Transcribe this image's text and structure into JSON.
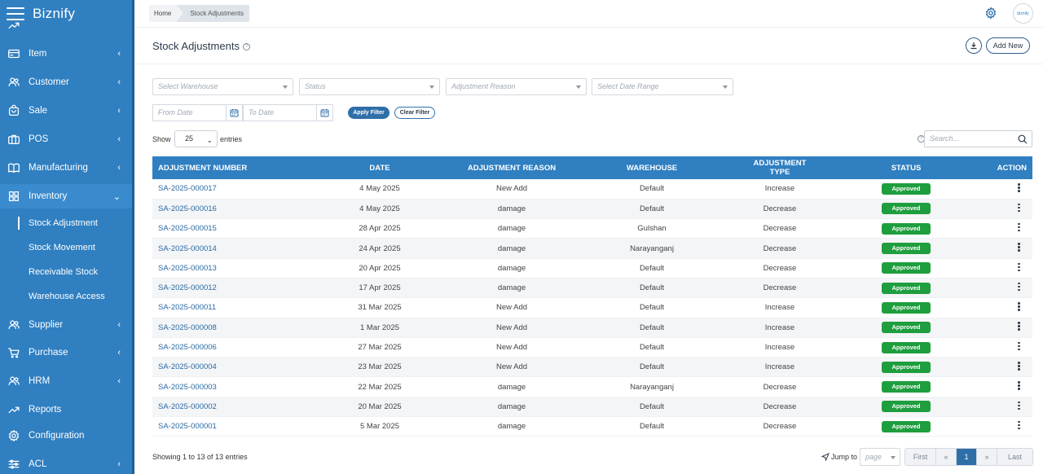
{
  "app": {
    "name": "Biznify",
    "avatar_text": "biznify"
  },
  "sidebar": {
    "items": [
      {
        "label": "Item",
        "icon": "card-icon"
      },
      {
        "label": "Customer",
        "icon": "users-icon"
      },
      {
        "label": "Sale",
        "icon": "bag-icon"
      },
      {
        "label": "POS",
        "icon": "briefcase-icon"
      },
      {
        "label": "Manufacturing",
        "icon": "book-icon"
      },
      {
        "label": "Inventory",
        "icon": "grid-icon"
      },
      {
        "label": "Supplier",
        "icon": "users-icon"
      },
      {
        "label": "Purchase",
        "icon": "cart-icon"
      },
      {
        "label": "HRM",
        "icon": "users-icon"
      },
      {
        "label": "Reports",
        "icon": "trend-icon"
      },
      {
        "label": "Configuration",
        "icon": "gear-icon"
      },
      {
        "label": "ACL",
        "icon": "sliders-icon"
      }
    ],
    "inventory_sub": [
      "Stock Adjustment",
      "Stock Movement",
      "Receivable Stock",
      "Warehouse Access"
    ]
  },
  "breadcrumb": {
    "home": "Home",
    "current": "Stock Adjustments"
  },
  "page": {
    "title": "Stock Adjustments",
    "info": "?",
    "add_new": "Add New"
  },
  "filters": {
    "warehouse": "Select Warehouse",
    "status": "Status",
    "reason": "Adjustment Reason",
    "date_range": "Select Date Range",
    "from_date": "From Date",
    "to_date": "To Date",
    "apply": "Apply Filter",
    "clear": "Clear Filter"
  },
  "table_controls": {
    "show": "Show",
    "page_size": "25",
    "entries": "entries",
    "search_placeholder": "Search..."
  },
  "table": {
    "columns": [
      "ADJUSTMENT NUMBER",
      "DATE",
      "ADJUSTMENT REASON",
      "WAREHOUSE",
      "ADJUSTMENT TYPE",
      "STATUS",
      "ACTION"
    ],
    "rows": [
      [
        "SA-2025-000017",
        "4 May 2025",
        "New Add",
        "Default",
        "Increase",
        "Approved"
      ],
      [
        "SA-2025-000016",
        "4 May 2025",
        "damage",
        "Default",
        "Decrease",
        "Approved"
      ],
      [
        "SA-2025-000015",
        "28 Apr 2025",
        "damage",
        "Gulshan",
        "Decrease",
        "Approved"
      ],
      [
        "SA-2025-000014",
        "24 Apr 2025",
        "damage",
        "Narayanganj",
        "Decrease",
        "Approved"
      ],
      [
        "SA-2025-000013",
        "20 Apr 2025",
        "damage",
        "Default",
        "Decrease",
        "Approved"
      ],
      [
        "SA-2025-000012",
        "17 Apr 2025",
        "damage",
        "Default",
        "Decrease",
        "Approved"
      ],
      [
        "SA-2025-000011",
        "31 Mar 2025",
        "New Add",
        "Default",
        "Increase",
        "Approved"
      ],
      [
        "SA-2025-000008",
        "1 Mar 2025",
        "New Add",
        "Default",
        "Increase",
        "Approved"
      ],
      [
        "SA-2025-000006",
        "27 Mar 2025",
        "New Add",
        "Default",
        "Increase",
        "Approved"
      ],
      [
        "SA-2025-000004",
        "23 Mar 2025",
        "New Add",
        "Default",
        "Increase",
        "Approved"
      ],
      [
        "SA-2025-000003",
        "22 Mar 2025",
        "damage",
        "Narayanganj",
        "Decrease",
        "Approved"
      ],
      [
        "SA-2025-000002",
        "20 Mar 2025",
        "damage",
        "Default",
        "Decrease",
        "Approved"
      ],
      [
        "SA-2025-000001",
        "5 Mar 2025",
        "damage",
        "Default",
        "Decrease",
        "Approved"
      ]
    ]
  },
  "footer": {
    "info": "Showing 1 to 13 of 13 entries",
    "jump_to": "Jump to",
    "page_placeholder": "page",
    "first": "First",
    "prev": "«",
    "current": "1",
    "next": "»",
    "last": "Last"
  },
  "colors": {
    "sidebar": "#2f7fc1",
    "header": "#2f7fc1",
    "badge": "#1e9e3e",
    "link": "#2a6aa3"
  }
}
